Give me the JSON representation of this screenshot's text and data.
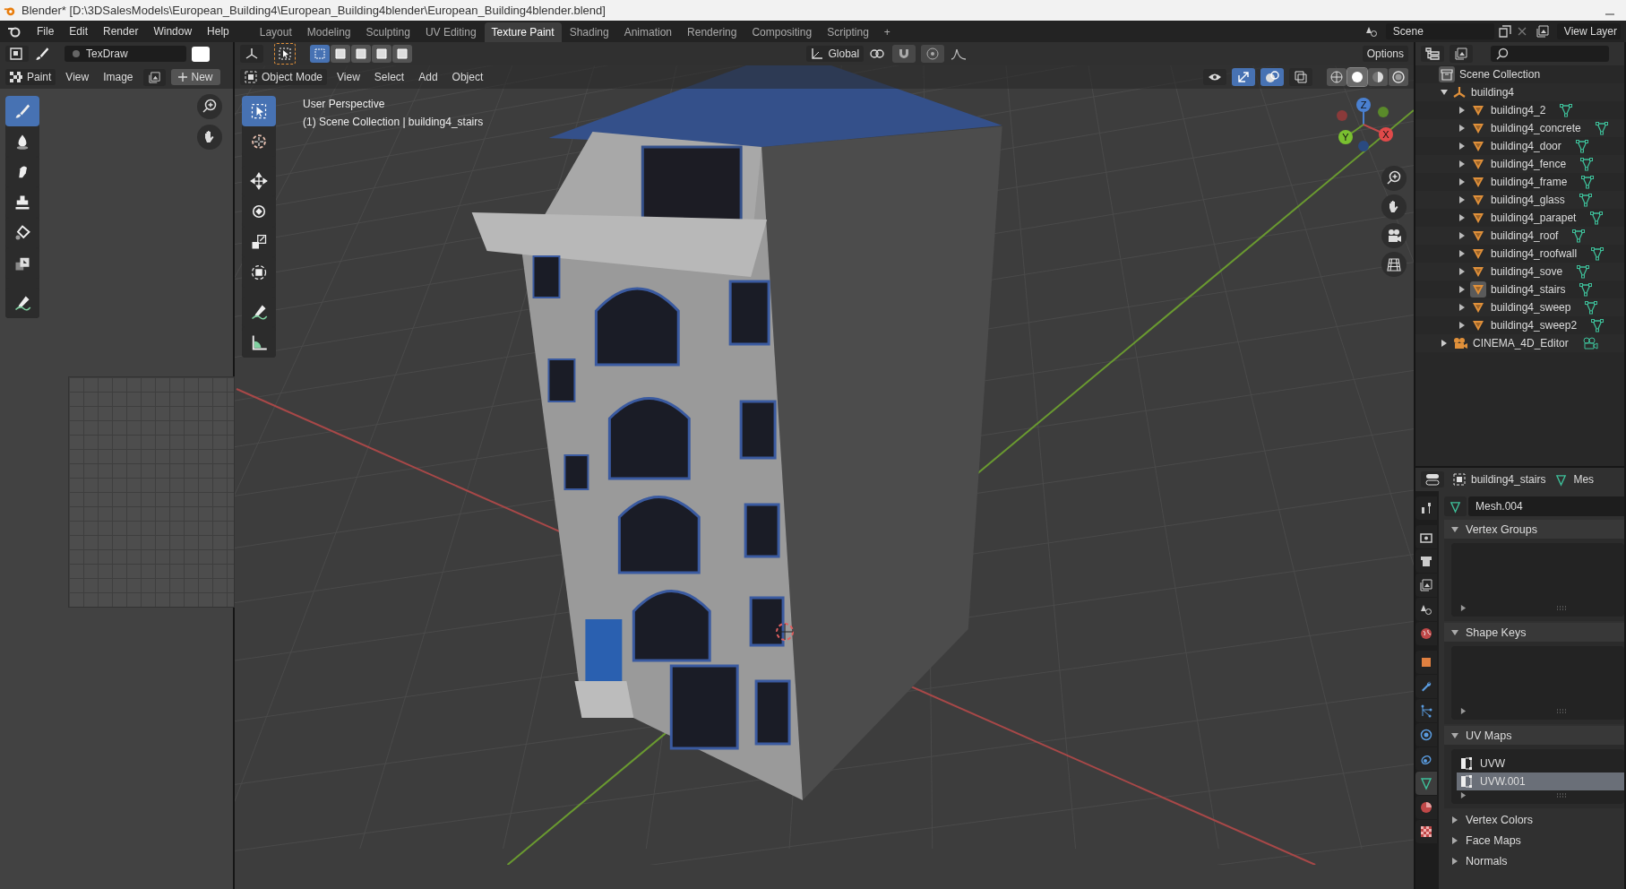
{
  "title_bar": {
    "title": "Blender* [D:\\3DSalesModels\\European_Building4\\European_Building4blender\\European_Building4blender.blend]"
  },
  "top_bar": {
    "menus": [
      "File",
      "Edit",
      "Render",
      "Window",
      "Help"
    ],
    "workspaces": [
      {
        "label": "Layout",
        "selected": false
      },
      {
        "label": "Modeling",
        "selected": false
      },
      {
        "label": "Sculpting",
        "selected": false
      },
      {
        "label": "UV Editing",
        "selected": false
      },
      {
        "label": "Texture Paint",
        "selected": true
      },
      {
        "label": "Shading",
        "selected": false
      },
      {
        "label": "Animation",
        "selected": false
      },
      {
        "label": "Rendering",
        "selected": false
      },
      {
        "label": "Compositing",
        "selected": false
      },
      {
        "label": "Scripting",
        "selected": false
      }
    ],
    "add_tab": "+",
    "scene_field": "Scene",
    "view_layer_field": "View Layer"
  },
  "image_editor": {
    "brush_name": "TexDraw",
    "mode": "Paint",
    "menus": [
      "View",
      "Image"
    ],
    "new_button": "New",
    "tools": [
      {
        "selected": true
      },
      {
        "selected": false
      },
      {
        "selected": false
      },
      {
        "selected": false
      },
      {
        "selected": false
      },
      {
        "selected": false
      },
      {
        "selected": false
      }
    ]
  },
  "viewport": {
    "orientation": "Global",
    "options": "Options",
    "mode": "Object Mode",
    "menus": [
      "View",
      "Select",
      "Add",
      "Object"
    ],
    "select_modes": [
      {
        "selected": true
      },
      {
        "selected": false
      },
      {
        "selected": false
      },
      {
        "selected": false
      },
      {
        "selected": false
      }
    ],
    "shading_modes": [
      {
        "selected": false
      },
      {
        "selected": true
      },
      {
        "selected": false
      },
      {
        "selected": false
      }
    ],
    "overlay_text": [
      "User Perspective",
      "(1) Scene Collection | building4_stairs"
    ],
    "gizmo_axes": [
      "Z",
      "Y",
      "X"
    ],
    "tools": [
      {
        "selected": true
      },
      {
        "selected": false
      },
      {
        "selected": false
      },
      {
        "selected": false
      },
      {
        "selected": false
      },
      {
        "selected": false
      },
      {
        "selected": false
      },
      {
        "selected": false
      }
    ]
  },
  "outliner": {
    "root": "Scene Collection",
    "tree": [
      {
        "label": "building4",
        "kind": "empty",
        "expanded": true,
        "children": [
          {
            "label": "building4_2",
            "kind": "mesh",
            "selected": false
          },
          {
            "label": "building4_concrete",
            "kind": "mesh",
            "selected": false
          },
          {
            "label": "building4_door",
            "kind": "mesh",
            "selected": false
          },
          {
            "label": "building4_fence",
            "kind": "mesh",
            "selected": false
          },
          {
            "label": "building4_frame",
            "kind": "mesh",
            "selected": false
          },
          {
            "label": "building4_glass",
            "kind": "mesh",
            "selected": false
          },
          {
            "label": "building4_parapet",
            "kind": "mesh",
            "selected": false
          },
          {
            "label": "building4_roof",
            "kind": "mesh",
            "selected": false
          },
          {
            "label": "building4_roofwall",
            "kind": "mesh",
            "selected": false
          },
          {
            "label": "building4_sove",
            "kind": "mesh",
            "selected": false
          },
          {
            "label": "building4_stairs",
            "kind": "mesh",
            "selected": true
          },
          {
            "label": "building4_sweep",
            "kind": "mesh",
            "selected": false
          },
          {
            "label": "building4_sweep2",
            "kind": "mesh",
            "selected": false
          }
        ]
      },
      {
        "label": "CINEMA_4D_Editor",
        "kind": "camera",
        "expanded": false
      }
    ]
  },
  "properties": {
    "object_name": "building4_stairs",
    "data_name": "Mes",
    "mesh_name": "Mesh.004",
    "tabs": [
      {
        "selected": false
      },
      {
        "selected": false
      },
      {
        "selected": false
      },
      {
        "selected": false
      },
      {
        "selected": false
      },
      {
        "selected": false
      },
      {
        "selected": false
      },
      {
        "selected": false
      },
      {
        "selected": false
      },
      {
        "selected": false
      },
      {
        "selected": false
      },
      {
        "selected": true
      },
      {
        "selected": false
      },
      {
        "selected": false
      }
    ],
    "panels": [
      {
        "title": "Vertex Groups",
        "expanded": true,
        "kind": "list"
      },
      {
        "title": "Shape Keys",
        "expanded": true,
        "kind": "list"
      },
      {
        "title": "UV Maps",
        "expanded": true,
        "kind": "list",
        "items": [
          {
            "name": "UVW",
            "selected": false
          },
          {
            "name": "UVW.001",
            "selected": true
          }
        ]
      },
      {
        "title": "Vertex Colors",
        "expanded": false
      },
      {
        "title": "Face Maps",
        "expanded": false
      },
      {
        "title": "Normals",
        "expanded": false
      }
    ]
  }
}
